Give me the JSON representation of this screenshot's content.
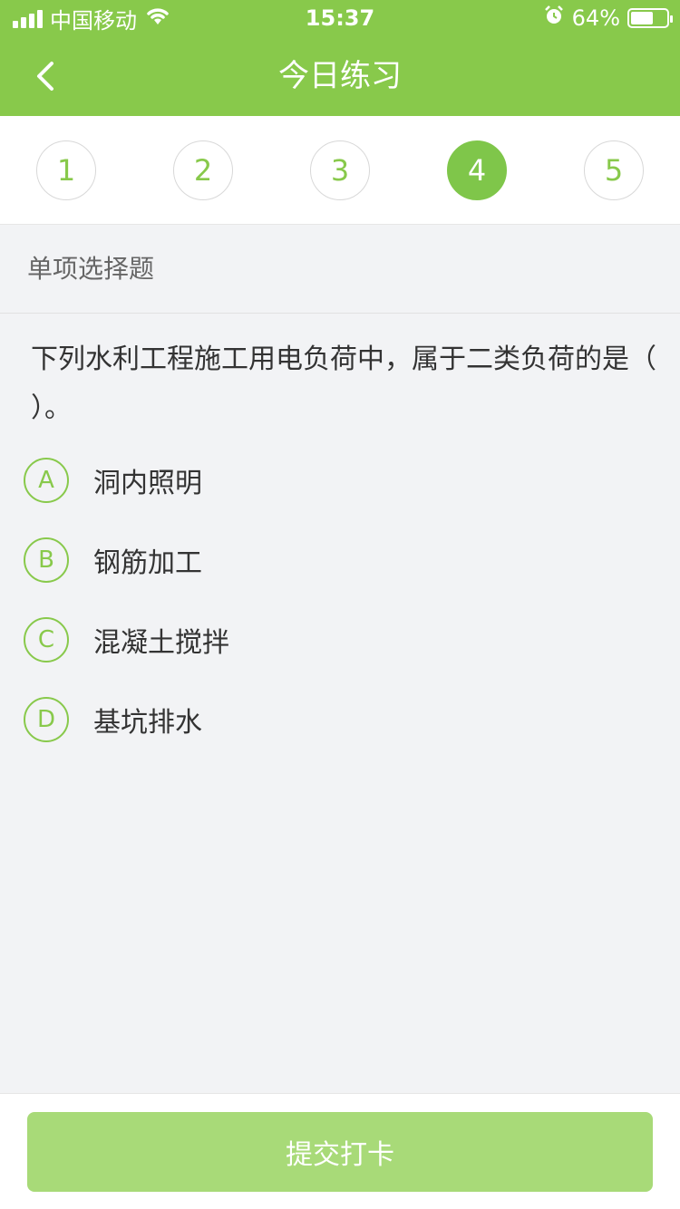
{
  "status_bar": {
    "carrier": "中国移动",
    "time": "15:37",
    "battery_percent": "64%",
    "battery_level": 0.64,
    "icons": [
      "signal-icon",
      "wifi-icon",
      "alarm-icon",
      "battery-icon"
    ]
  },
  "header": {
    "title": "今日练习",
    "back_icon": "chevron-left-icon"
  },
  "steps": [
    {
      "label": "1",
      "active": false
    },
    {
      "label": "2",
      "active": false
    },
    {
      "label": "3",
      "active": false
    },
    {
      "label": "4",
      "active": true
    },
    {
      "label": "5",
      "active": false
    }
  ],
  "question": {
    "type": "单项选择题",
    "text": "下列水利工程施工用电负荷中，属于二类负荷的是（ ）。",
    "options": [
      {
        "letter": "A",
        "text": "洞内照明"
      },
      {
        "letter": "B",
        "text": "钢筋加工"
      },
      {
        "letter": "C",
        "text": "混凝土搅拌"
      },
      {
        "letter": "D",
        "text": "基坑排水"
      }
    ]
  },
  "footer": {
    "submit_label": "提交打卡"
  },
  "colors": {
    "primary": "#88c94b",
    "active_step": "#7fc64a",
    "button": "#a8da78",
    "background": "#f2f3f5"
  }
}
